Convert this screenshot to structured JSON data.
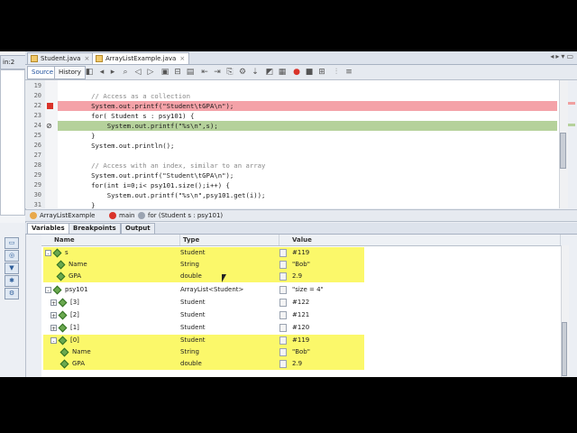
{
  "window": {
    "left_tab": "in:2",
    "tabs": [
      {
        "label": "Student.java",
        "active": false
      },
      {
        "label": "ArrayListExample.java",
        "active": true
      }
    ]
  },
  "toolbar": {
    "source_label": "Source",
    "history_label": "History"
  },
  "editor": {
    "lines": [
      {
        "num": "19",
        "text": ""
      },
      {
        "num": "20",
        "text": "        // Access as a collection"
      },
      {
        "num": "22",
        "text": "        System.out.printf(\"Student\\tGPA\\n\");",
        "state": "breakpoint"
      },
      {
        "num": "23",
        "text": "        for( Student s : psy101) {"
      },
      {
        "num": "24",
        "text": "            System.out.printf(\"%s\\n\",s);",
        "state": "current"
      },
      {
        "num": "25",
        "text": "        }"
      },
      {
        "num": "26",
        "text": "        System.out.println();"
      },
      {
        "num": "27",
        "text": ""
      },
      {
        "num": "28",
        "text": "        // Access with an index, similar to an array"
      },
      {
        "num": "29",
        "text": "        System.out.printf(\"Student\\tGPA\\n\");"
      },
      {
        "num": "29",
        "text": "        for(int i=0;i< psy101.size();i++) {"
      },
      {
        "num": "30",
        "text": "            System.out.printf(\"%s\\n\",psy101.get(i));"
      },
      {
        "num": "31",
        "text": "        }"
      }
    ]
  },
  "breadcrumb": {
    "items": [
      "ArrayListExample",
      "main",
      "for (Student s : psy101)"
    ]
  },
  "debug_tabs": [
    "Variables",
    "Breakpoints",
    "Output"
  ],
  "variables": {
    "headers": {
      "name": "Name",
      "type": "Type",
      "value": "Value"
    },
    "rows": [
      {
        "indent": 0,
        "expander": "-",
        "name": "s",
        "type": "Student",
        "value": "#119",
        "highlight": true
      },
      {
        "indent": 1,
        "expander": "",
        "name": "Name",
        "type": "String",
        "value": "\"Bob\"",
        "highlight": true
      },
      {
        "indent": 1,
        "expander": "",
        "name": "GPA",
        "type": "double",
        "value": "2.9",
        "highlight": true
      },
      {
        "indent": 0,
        "expander": "-",
        "name": "psy101",
        "type": "ArrayList<Student>",
        "value": "\"size = 4\"",
        "highlight": false
      },
      {
        "indent": 1,
        "expander": "+",
        "name": "[3]",
        "type": "Student",
        "value": "#122",
        "highlight": false
      },
      {
        "indent": 1,
        "expander": "+",
        "name": "[2]",
        "type": "Student",
        "value": "#121",
        "highlight": false
      },
      {
        "indent": 1,
        "expander": "+",
        "name": "[1]",
        "type": "Student",
        "value": "#120",
        "highlight": false
      },
      {
        "indent": 1,
        "expander": "-",
        "name": "[0]",
        "type": "Student",
        "value": "#119",
        "highlight": true
      },
      {
        "indent": 2,
        "expander": "",
        "name": "Name",
        "type": "String",
        "value": "\"Bob\"",
        "highlight": true
      },
      {
        "indent": 2,
        "expander": "",
        "name": "GPA",
        "type": "double",
        "value": "2.9",
        "highlight": true
      }
    ]
  },
  "colors": {
    "breakpoint_line": "#f4a2a8",
    "current_line": "#b5d19b",
    "highlight": "#fbf86a"
  }
}
